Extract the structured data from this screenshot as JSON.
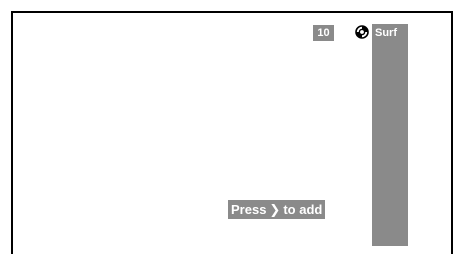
{
  "track": {
    "number": "10"
  },
  "surf_panel": {
    "label": "Surf",
    "icon": "disc-icon"
  },
  "hint": {
    "before": "Press",
    "arrow": "❯",
    "after": "to add"
  },
  "colors": {
    "panel": "#8a8a8a",
    "background": "#ffffff",
    "frame": "#000000",
    "text": "#ffffff"
  }
}
